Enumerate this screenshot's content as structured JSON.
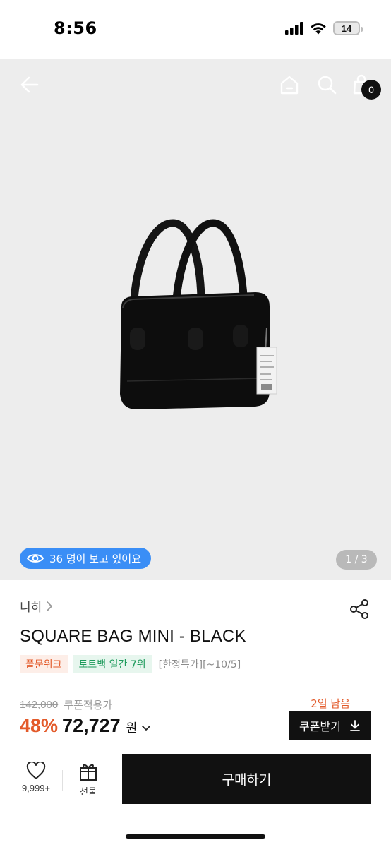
{
  "status_bar": {
    "time": "8:56",
    "battery": "14",
    "icons": [
      "cellular-signal-icon",
      "wifi-icon",
      "battery-icon"
    ]
  },
  "top_nav": {
    "icons": [
      "back-arrow-icon",
      "home-icon",
      "search-icon",
      "shopping-bag-icon"
    ],
    "cart_count": "0"
  },
  "hero": {
    "viewer_text": "36 명이 보고 있어요",
    "page_indicator": "1 / 3"
  },
  "product": {
    "brand": "니히",
    "title": "SQUARE BAG MINI - BLACK",
    "tags": [
      "풀문위크",
      "토트백 일간 7위"
    ],
    "promo_text": "[한정특가][~10/5]",
    "original_price": "142,000",
    "price_type": "쿠폰적용가",
    "time_left": "2일 남음",
    "discount": "48%",
    "price": "72,727",
    "currency": "원",
    "coupon_button": "쿠폰받기"
  },
  "bottom_bar": {
    "like_count": "9,999+",
    "gift_label": "선물",
    "buy_label": "구매하기"
  },
  "colors": {
    "accent_orange": "#e35a2a",
    "accent_green": "#1e9b5c",
    "viewer_blue": "#3a8ef6",
    "dark": "#111111"
  }
}
